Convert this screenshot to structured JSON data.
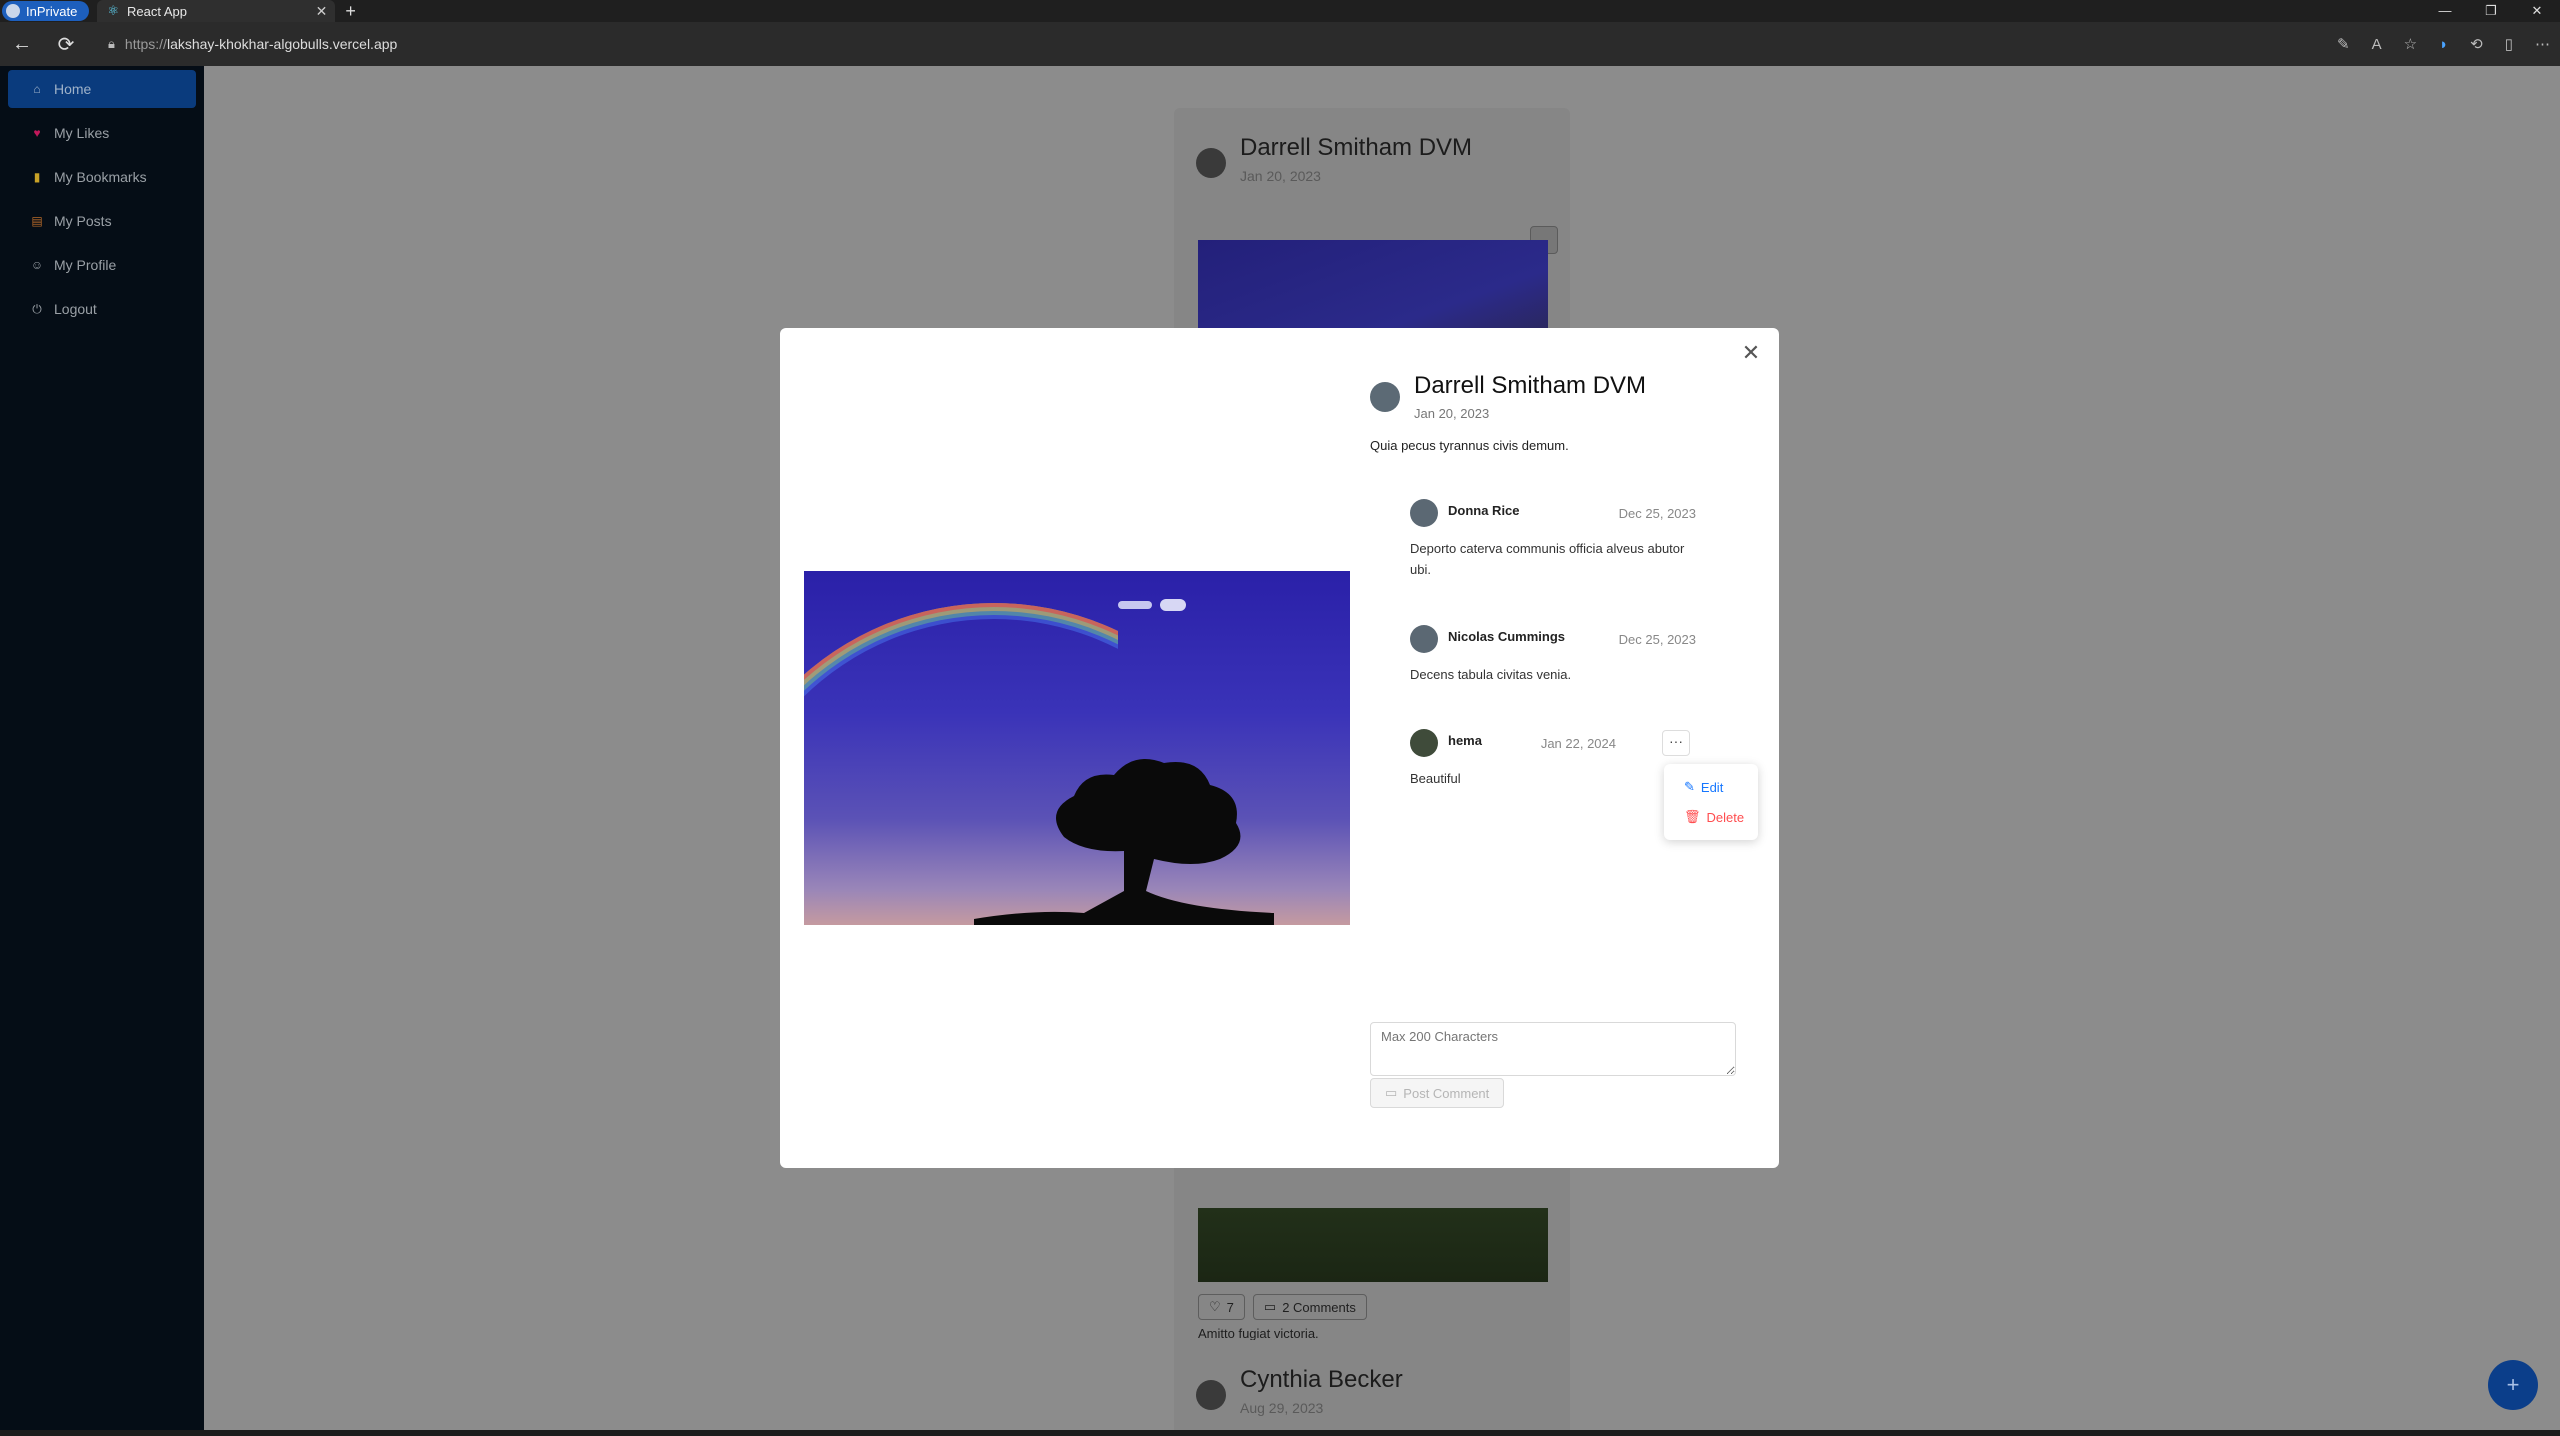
{
  "browser": {
    "inprivate_label": "InPrivate",
    "tab_title": "React App",
    "url_proto": "https://",
    "url_host": "lakshay-khokhar-algobulls.vercel.app"
  },
  "sidebar": {
    "items": [
      {
        "label": "Home",
        "icon": "home-icon",
        "active": true
      },
      {
        "label": "My Likes",
        "icon": "heart-icon"
      },
      {
        "label": "My Bookmarks",
        "icon": "bookmark-icon"
      },
      {
        "label": "My Posts",
        "icon": "posts-icon"
      },
      {
        "label": "My Profile",
        "icon": "user-icon"
      },
      {
        "label": "Logout",
        "icon": "logout-icon"
      }
    ]
  },
  "feed": {
    "card1": {
      "author": "Darrell Smitham DVM",
      "date": "Jan 20, 2023",
      "likes": "7",
      "comments": "2 Comments",
      "caption": "Amitto fugiat victoria."
    },
    "card2": {
      "author": "Cynthia Becker",
      "date": "Aug 29, 2023"
    }
  },
  "modal": {
    "author": "Darrell Smitham DVM",
    "date": "Jan 20, 2023",
    "text": "Quia pecus tyrannus civis demum.",
    "comments": [
      {
        "name": "Donna Rice",
        "date": "Dec 25, 2023",
        "text": "Deporto caterva communis officia alveus abutor ubi."
      },
      {
        "name": "Nicolas Cummings",
        "date": "Dec 25, 2023",
        "text": "Decens tabula civitas venia."
      },
      {
        "name": "hema",
        "date": "Jan 22, 2024",
        "text": "Beautiful"
      }
    ],
    "menu": {
      "edit": "Edit",
      "delete": "Delete"
    },
    "comment_placeholder": "Max 200 Characters",
    "post_button": "Post Comment"
  },
  "colors": {
    "accent": "#1677ff",
    "danger": "#ff4d4f",
    "sidebar_bg": "#001529"
  }
}
